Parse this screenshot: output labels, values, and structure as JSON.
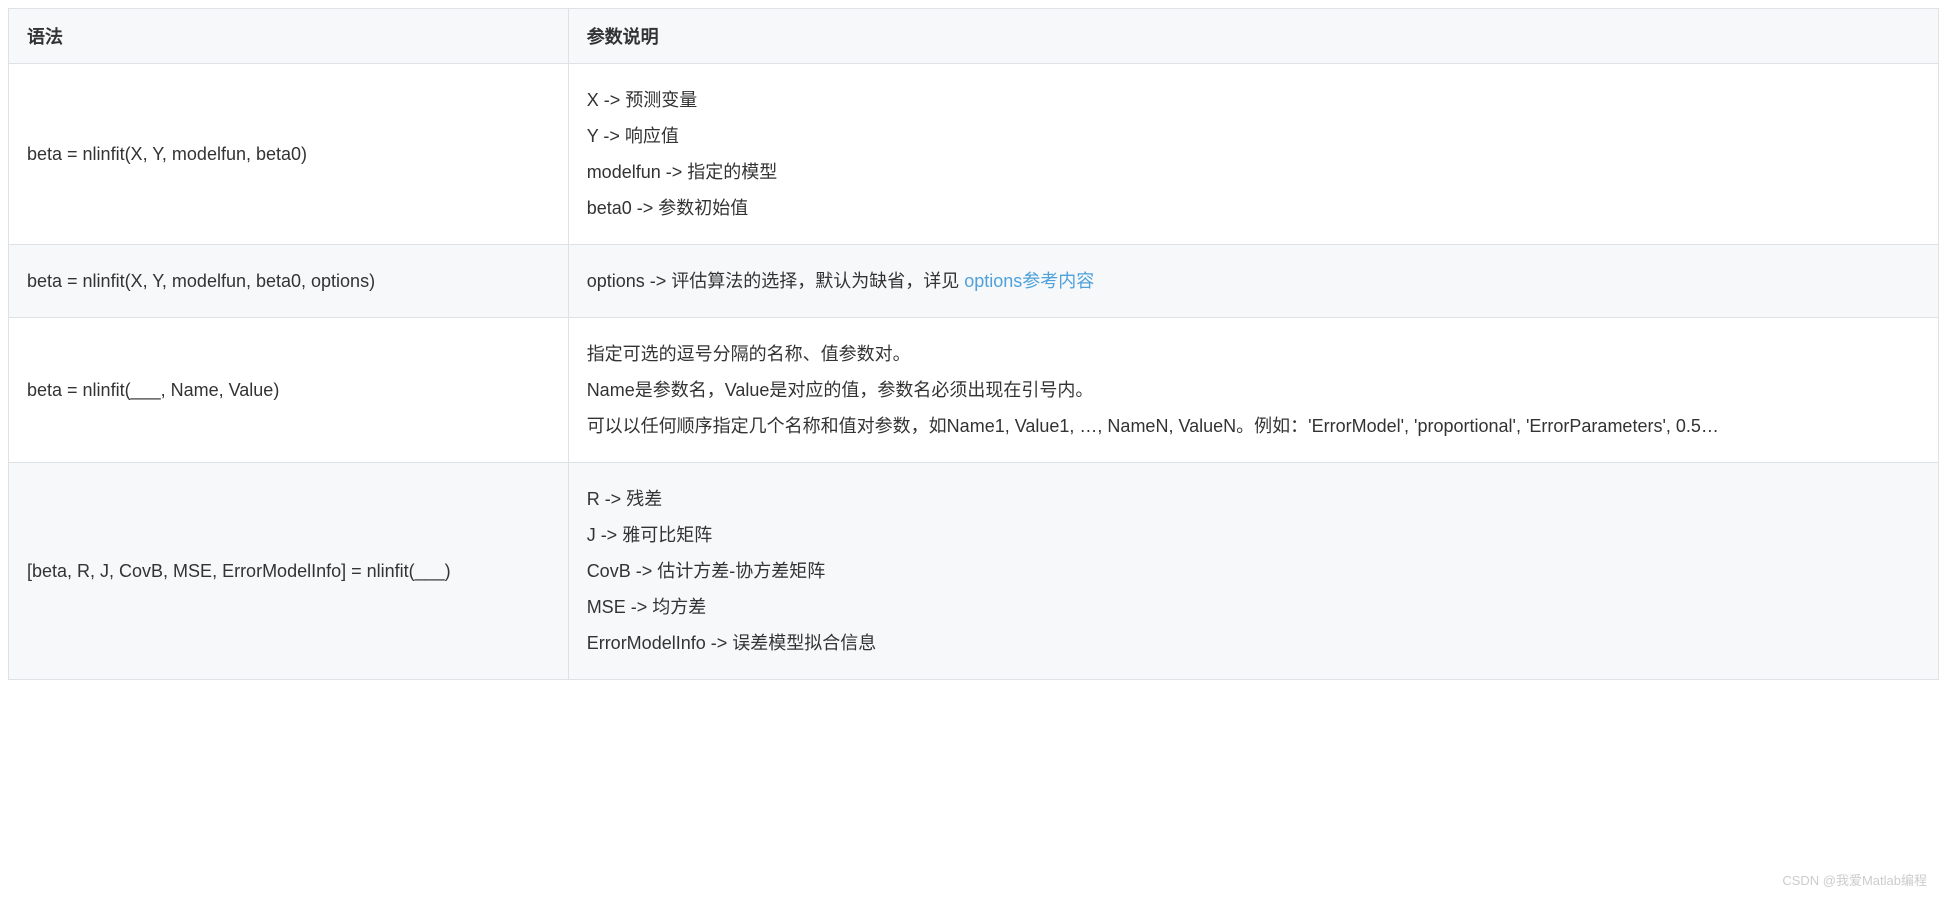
{
  "table": {
    "headers": {
      "syntax": "语法",
      "description": "参数说明"
    },
    "rows": [
      {
        "syntax": "beta = nlinfit(X, Y, modelfun, beta0)",
        "desc_lines": [
          "X -> 预测变量",
          "Y -> 响应值",
          "modelfun -> 指定的模型",
          "beta0 -> 参数初始值"
        ]
      },
      {
        "syntax": "beta = nlinfit(X, Y, modelfun, beta0, options)",
        "desc_prefix": "options -> 评估算法的选择，默认为缺省，详见 ",
        "link_text": "options参考内容"
      },
      {
        "syntax": "beta = nlinfit(___, Name, Value)",
        "desc_lines": [
          "指定可选的逗号分隔的名称、值参数对。",
          "Name是参数名，Value是对应的值，参数名必须出现在引号内。",
          "可以以任何顺序指定几个名称和值对参数，如Name1, Value1, …, NameN, ValueN。例如：'ErrorModel', 'proportional', 'ErrorParameters', 0.5…"
        ]
      },
      {
        "syntax": "[beta, R, J, CovB, MSE, ErrorModelInfo] = nlinfit(___)",
        "desc_lines": [
          "R -> 残差",
          "J -> 雅可比矩阵",
          "CovB -> 估计方差-协方差矩阵",
          "MSE -> 均方差",
          "ErrorModelInfo -> 误差模型拟合信息"
        ]
      }
    ]
  },
  "watermark": "CSDN @我爱Matlab编程"
}
